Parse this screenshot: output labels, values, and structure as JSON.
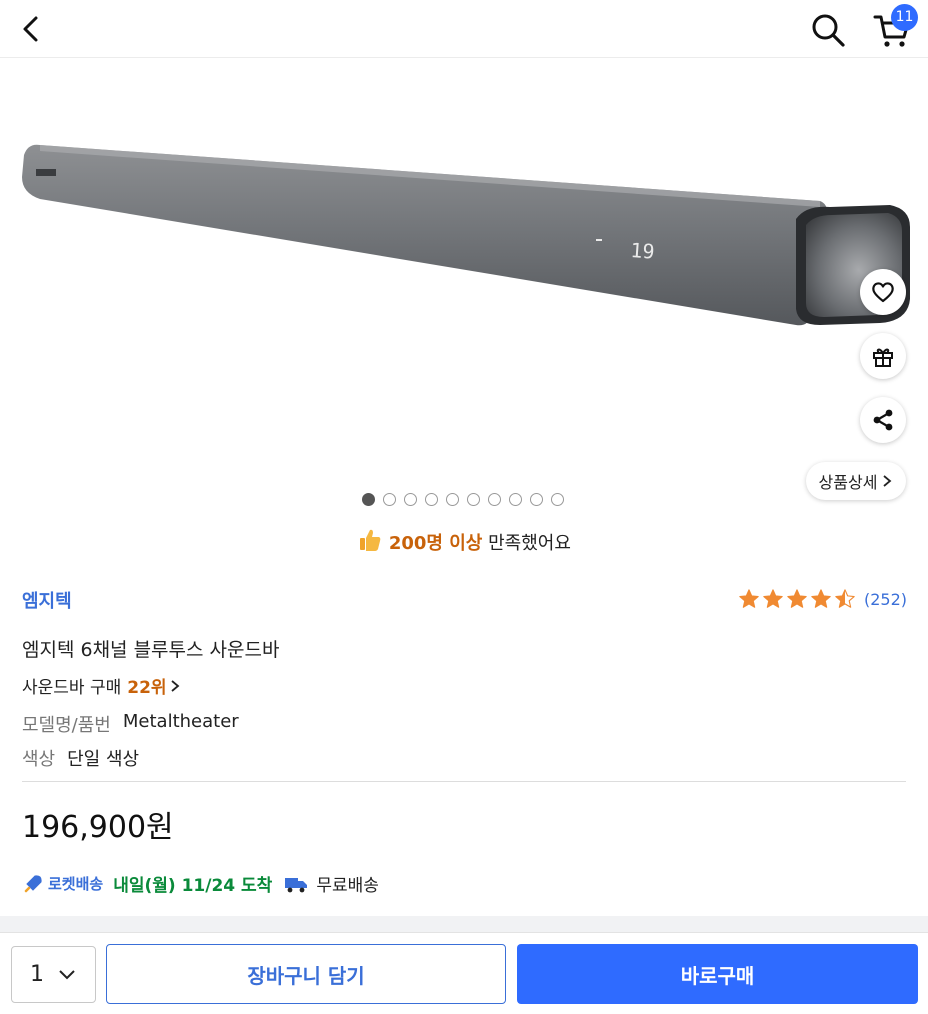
{
  "header": {
    "back_icon": "chevron-left-icon",
    "search_icon": "search-icon",
    "cart_icon": "cart-icon",
    "cart_count": "11",
    "accent": "#2f6bff"
  },
  "gallery": {
    "image_count": 10,
    "active_index": 0,
    "detail_label": "상품상세",
    "side_actions": [
      "heart-icon",
      "gift-icon",
      "share-icon"
    ]
  },
  "satisfaction": {
    "icon": "thumbs-up-icon",
    "highlight": "200명 이상",
    "rest": " 만족했어요"
  },
  "product": {
    "brand": "엠지텍",
    "rating": 4.5,
    "review_count": "(252)",
    "title": "엠지텍 6채널 블루투스 사운드바",
    "rank_label": "사운드바 구매",
    "rank_value": "22위",
    "specs": [
      {
        "key": "모델명/품번",
        "value": "Metaltheater"
      },
      {
        "key": "색상",
        "value": "단일 색상"
      }
    ],
    "price": "196,900원"
  },
  "delivery": {
    "rocket_label": "로켓배송",
    "date": "내일(월) 11/24 도착",
    "free_label": "무료배송",
    "date_color": "#0a8a3a"
  },
  "bottom_bar": {
    "quantity": "1",
    "add_to_cart": "장바구니 담기",
    "buy_now": "바로구매"
  }
}
